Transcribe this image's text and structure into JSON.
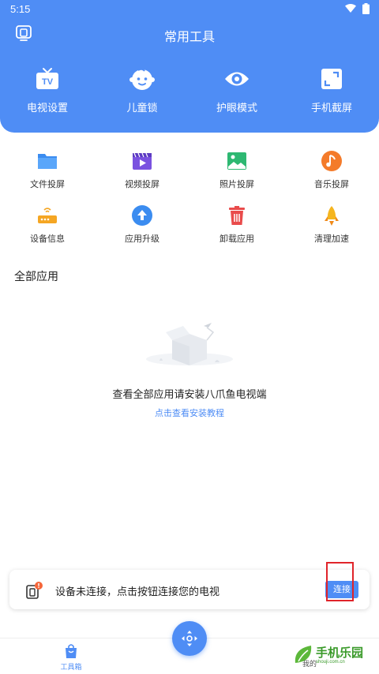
{
  "status_bar": {
    "time": "5:15"
  },
  "header": {
    "title": "常用工具"
  },
  "top_tools": [
    {
      "label": "电视设置",
      "icon": "tv-icon"
    },
    {
      "label": "儿童锁",
      "icon": "child-face-icon"
    },
    {
      "label": "护眼模式",
      "icon": "eye-icon"
    },
    {
      "label": "手机截屏",
      "icon": "screenshot-icon"
    }
  ],
  "tools_grid": [
    {
      "label": "文件投屏",
      "icon": "folder-icon"
    },
    {
      "label": "视频投屏",
      "icon": "video-icon"
    },
    {
      "label": "照片投屏",
      "icon": "photo-icon"
    },
    {
      "label": "音乐投屏",
      "icon": "music-icon"
    },
    {
      "label": "设备信息",
      "icon": "router-icon"
    },
    {
      "label": "应用升级",
      "icon": "upgrade-icon"
    },
    {
      "label": "卸载应用",
      "icon": "trash-icon"
    },
    {
      "label": "清理加速",
      "icon": "rocket-icon"
    }
  ],
  "all_apps": {
    "title": "全部应用",
    "empty_text": "查看全部应用请安装八爪鱼电视端",
    "tutorial_link": "点击查看安装教程"
  },
  "connect_card": {
    "text": "设备未连接，点击按钮连接您的电视",
    "button_label": "连接"
  },
  "bottom_nav": {
    "tools_label": "工具箱",
    "mine_label": "我的"
  },
  "watermark": {
    "main": "手机乐园",
    "sub": "shouji.com.cn"
  },
  "colors": {
    "primary": "#4F8DF5",
    "highlight": "#e0242a"
  }
}
